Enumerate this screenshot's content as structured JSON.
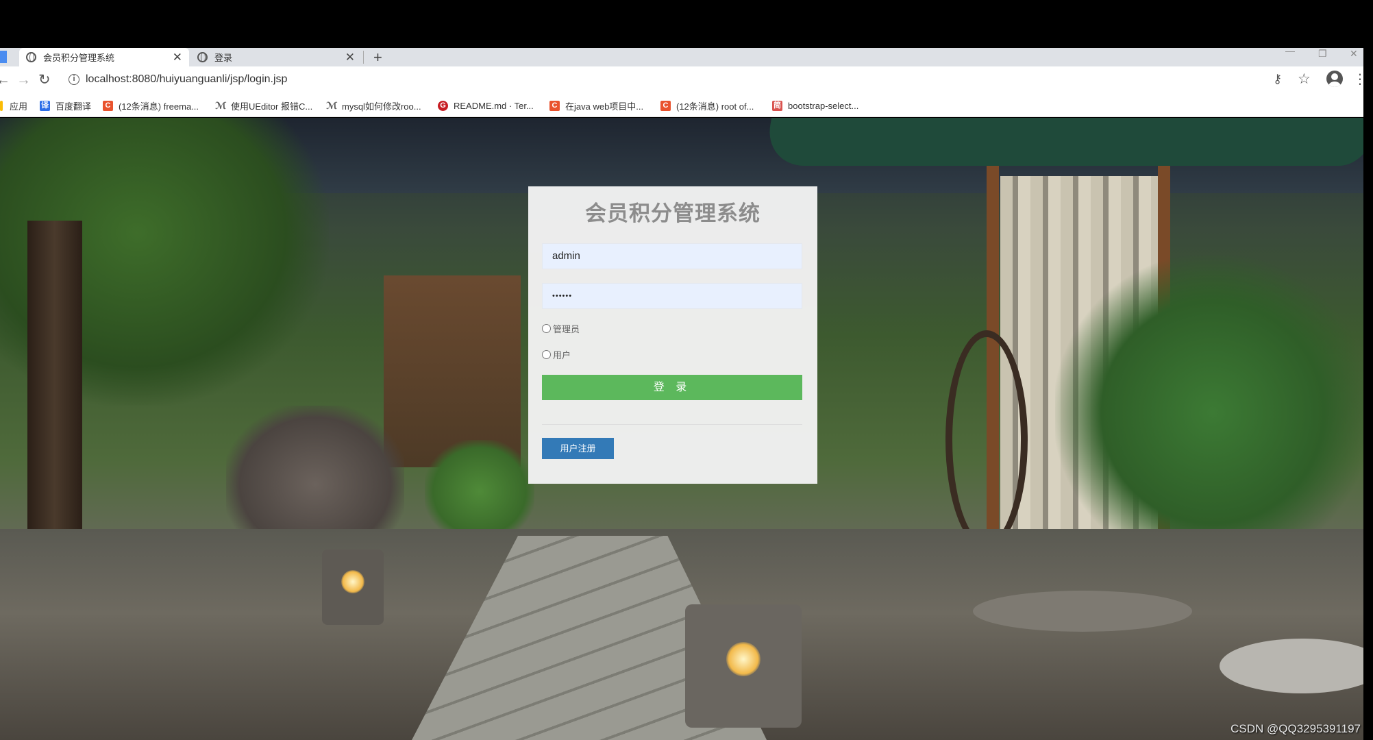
{
  "browser": {
    "tabs": [
      {
        "title": "会员积分管理系统",
        "active": true
      },
      {
        "title": "登录",
        "active": false
      }
    ],
    "address_url": "localhost:8080/huiyuanguanli/jsp/login.jsp",
    "bookmarks": [
      {
        "label": "应用",
        "icon": "apps-icon",
        "color": "#4285f4"
      },
      {
        "label": "百度翻译",
        "icon": "baidu-translate-icon",
        "color": "#2e6fe8"
      },
      {
        "label": "(12条消息) freema...",
        "icon": "csdn-icon",
        "color": "#e9532e"
      },
      {
        "label": "使用UEditor 报错C...",
        "icon": "bookmark-logo-icon",
        "color": "#555555"
      },
      {
        "label": "mysql如何修改roo...",
        "icon": "bookmark-logo-icon",
        "color": "#555555"
      },
      {
        "label": "README.md · Ter...",
        "icon": "gitee-icon",
        "color": "#c71d23"
      },
      {
        "label": "在java web项目中...",
        "icon": "csdn-icon",
        "color": "#e9532e"
      },
      {
        "label": "(12条消息) root of...",
        "icon": "csdn-icon",
        "color": "#e9532e"
      },
      {
        "label": "bootstrap-select...",
        "icon": "bookmark-site-icon",
        "color": "#d9534f"
      }
    ]
  },
  "login": {
    "title": "会员积分管理系统",
    "username": "admin",
    "password": "••••••",
    "roles": [
      "管理员",
      "用户"
    ],
    "login_button": "登 录",
    "register_button": "用户注册"
  },
  "colors": {
    "login_button": "#5cb85c",
    "register_button": "#337ab7",
    "input_bg": "#e8f0fe",
    "card_bg": "#f2f2f2"
  },
  "watermark": "CSDN @QQ3295391197"
}
